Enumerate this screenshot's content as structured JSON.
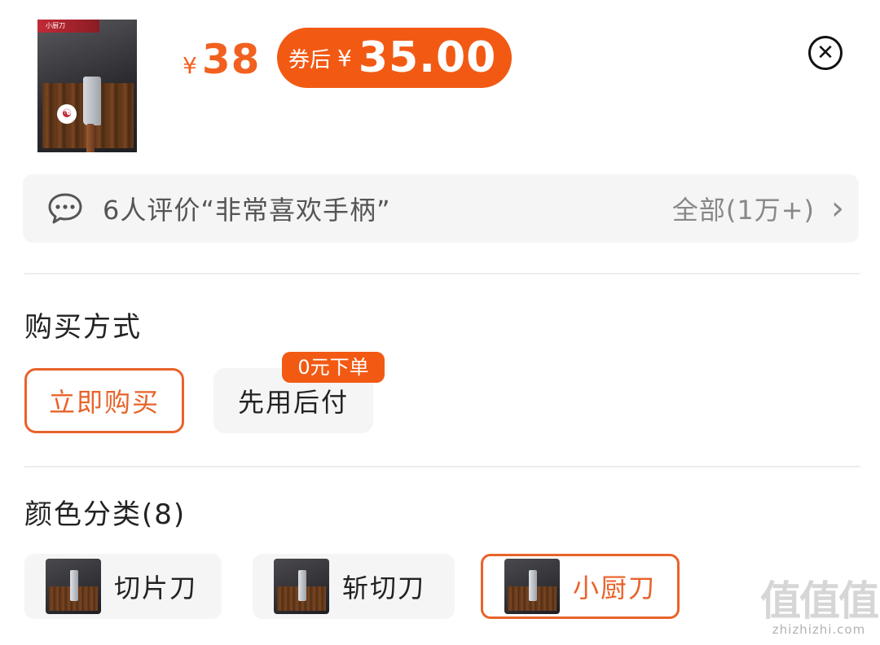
{
  "product": {
    "thumb_tag": "小厨刀",
    "thumb_logo_icon": "brand-logo-icon"
  },
  "price": {
    "currency": "¥",
    "current": "38",
    "coupon_label": "券后",
    "coupon_currency": "¥",
    "coupon_price": "35.00"
  },
  "close_icon": "✕",
  "reviews": {
    "summary": "6人评价“非常喜欢手柄”",
    "all_label": "全部(1万+)",
    "chevron": "›"
  },
  "purchase": {
    "title": "购买方式",
    "options": [
      {
        "label": "立即购买",
        "selected": true
      },
      {
        "label": "先用后付",
        "selected": false,
        "badge": "0元下单"
      }
    ]
  },
  "variants": {
    "title": "颜色分类(8)",
    "items": [
      {
        "label": "切片刀",
        "selected": false
      },
      {
        "label": "斩切刀",
        "selected": false
      },
      {
        "label": "小厨刀",
        "selected": true
      }
    ]
  },
  "watermark": {
    "logo": "值值值",
    "url": "zhizhizhi.com"
  },
  "colors": {
    "accent": "#f25a14",
    "accent_border": "#e8632a",
    "panel_bg": "#f5f5f5"
  }
}
